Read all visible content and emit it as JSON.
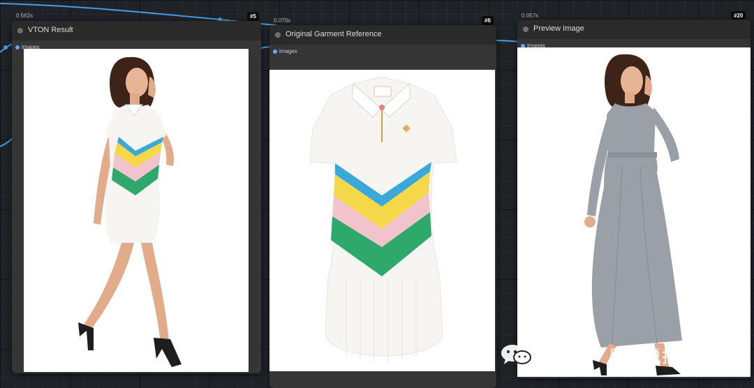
{
  "nodes": [
    {
      "id": "#5",
      "time": "0.562s",
      "title": "VTON Result",
      "slot": "images"
    },
    {
      "id": "#6",
      "time": "0.070s",
      "title": "Original Garment Reference",
      "slot": "images"
    },
    {
      "id": "#20",
      "time": "0.057s",
      "title": "Preview Image",
      "slot": "images"
    }
  ],
  "watermark": {
    "text": "公众号 · 壁虎说技术",
    "icon": "wechat-icon"
  },
  "colors": {
    "link": "#4a9be3",
    "canvas": "#1f2328",
    "node_body": "#353535",
    "node_header": "#2a2a2a",
    "stripe_blue": "#3aa9d9",
    "stripe_yellow": "#f5d84a",
    "stripe_pink": "#f2c3cc",
    "stripe_green": "#2fa86c",
    "grey_dress": "#9aa0a6"
  }
}
